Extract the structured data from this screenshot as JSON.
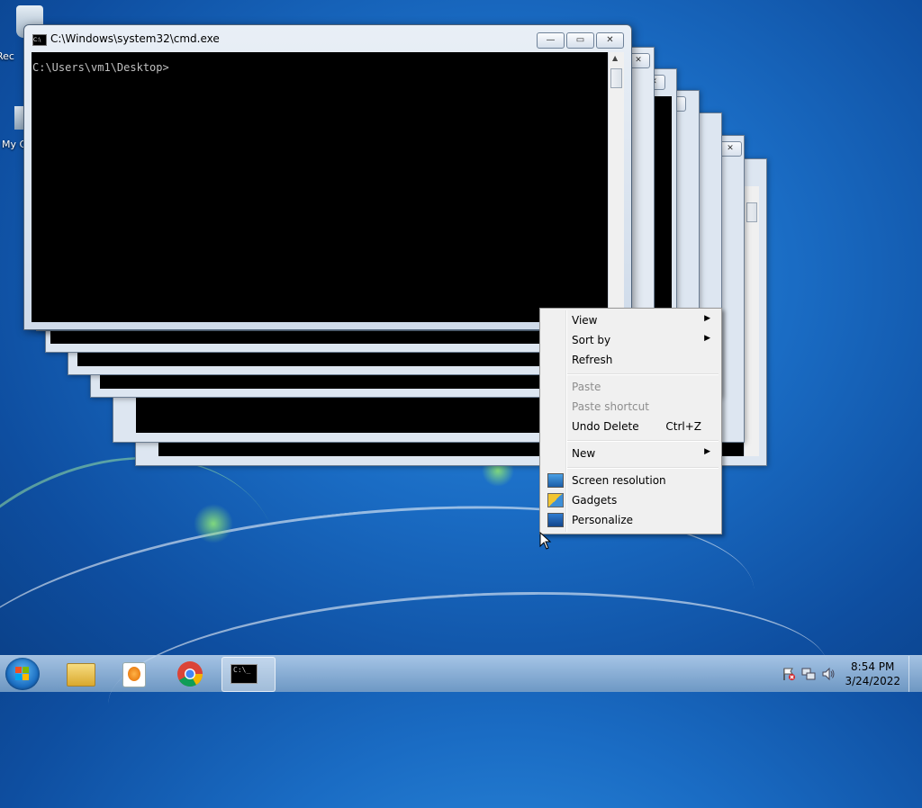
{
  "desktop": {
    "icons": [
      {
        "label": "Rec"
      },
      {
        "label": "My C"
      }
    ]
  },
  "cmd_window": {
    "title": "C:\\Windows\\system32\\cmd.exe",
    "prompt": "C:\\Users\\vm1\\Desktop>",
    "minimize": "—",
    "maximize": "▭",
    "close": "✕"
  },
  "context_menu": {
    "items": [
      {
        "label": "View",
        "submenu": true
      },
      {
        "label": "Sort by",
        "submenu": true
      },
      {
        "label": "Refresh"
      },
      {
        "label": "Paste",
        "disabled": true
      },
      {
        "label": "Paste shortcut",
        "disabled": true
      },
      {
        "label": "Undo Delete",
        "shortcut": "Ctrl+Z"
      },
      {
        "label": "New",
        "submenu": true
      },
      {
        "label": "Screen resolution",
        "icon": "screen-resolution-icon"
      },
      {
        "label": "Gadgets",
        "icon": "gadgets-icon"
      },
      {
        "label": "Personalize",
        "icon": "personalize-icon"
      }
    ],
    "submenu_arrow": "▶"
  },
  "taskbar": {
    "pinned": [
      {
        "name": "file-explorer-icon"
      },
      {
        "name": "media-player-icon"
      },
      {
        "name": "chrome-icon"
      },
      {
        "name": "cmd-icon",
        "active": true
      }
    ],
    "cmd_icon_text": "C:\\_",
    "clock_time": "8:54 PM",
    "clock_date": "3/24/2022"
  }
}
